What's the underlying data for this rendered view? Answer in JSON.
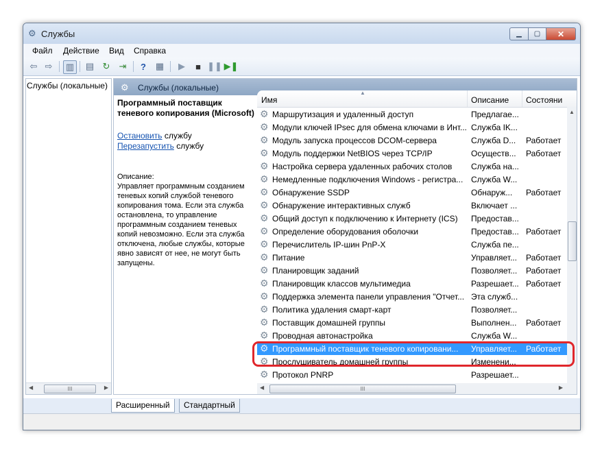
{
  "window": {
    "title": "Службы",
    "icon": "gear-icon"
  },
  "menu": [
    "Файл",
    "Действие",
    "Вид",
    "Справка"
  ],
  "toolbar": {
    "icons": [
      "back-arrow-icon",
      "forward-arrow-icon",
      "show-hide-console-tree-icon",
      "properties-icon",
      "refresh-icon",
      "export-list-icon",
      "help-icon",
      "show-hide-action-pane-icon",
      "start-service-icon",
      "stop-service-icon",
      "pause-service-icon",
      "restart-service-icon"
    ],
    "icon_colors": {
      "play": "#8a9bb0",
      "stop": "#333333",
      "pause": "#8a9bb0",
      "restart": "#2e9a2e"
    }
  },
  "tree": {
    "root": "Службы (локальные)"
  },
  "pane": {
    "header": "Службы (локальные)"
  },
  "description": {
    "title": "Программный поставщик теневого копирования (Microsoft)",
    "stop_link": "Остановить",
    "stop_suffix": " службу",
    "restart_link": "Перезапустить",
    "restart_suffix": " службу",
    "label": "Описание:",
    "text": "Управляет программным созданием теневых копий службой теневого копирования тома. Если эта служба остановлена, то управление программным созданием теневых копий невозможно. Если эта служба отключена, любые службы, которые явно зависят от нее, не могут быть запущены."
  },
  "columns": {
    "name": "Имя",
    "description": "Описание",
    "status": "Состояни"
  },
  "services": [
    {
      "name": "Маршрутизация и удаленный доступ",
      "description": "Предлагае...",
      "status": ""
    },
    {
      "name": "Модули ключей IPsec для обмена ключами в Инт...",
      "description": "Служба IK...",
      "status": ""
    },
    {
      "name": "Модуль запуска процессов DCOM-сервера",
      "description": "Служба D...",
      "status": "Работает"
    },
    {
      "name": "Модуль поддержки NetBIOS через TCP/IP",
      "description": "Осуществ...",
      "status": "Работает"
    },
    {
      "name": "Настройка сервера удаленных рабочих столов",
      "description": "Служба на...",
      "status": ""
    },
    {
      "name": "Немедленные подключения Windows - регистра...",
      "description": "Служба W...",
      "status": ""
    },
    {
      "name": "Обнаружение SSDP",
      "description": "Обнаруж...",
      "status": "Работает"
    },
    {
      "name": "Обнаружение интерактивных служб",
      "description": "Включает ...",
      "status": ""
    },
    {
      "name": "Общий доступ к подключению к Интернету (ICS)",
      "description": "Предостав...",
      "status": ""
    },
    {
      "name": "Определение оборудования оболочки",
      "description": "Предостав...",
      "status": "Работает"
    },
    {
      "name": "Перечислитель IP-шин PnP-X",
      "description": "Служба пе...",
      "status": ""
    },
    {
      "name": "Питание",
      "description": "Управляет...",
      "status": "Работает"
    },
    {
      "name": "Планировщик заданий",
      "description": "Позволяет...",
      "status": "Работает"
    },
    {
      "name": "Планировщик классов мультимедиа",
      "description": "Разрешает...",
      "status": "Работает"
    },
    {
      "name": "Поддержка элемента панели управления \"Отчет...",
      "description": "Эта служб...",
      "status": ""
    },
    {
      "name": "Политика удаления смарт-карт",
      "description": "Позволяет...",
      "status": ""
    },
    {
      "name": "Поставщик домашней группы",
      "description": "Выполнен...",
      "status": "Работает"
    },
    {
      "name": "Проводная автонастройка",
      "description": "Служба W...",
      "status": ""
    },
    {
      "name": "Программный поставщик теневого копировани...",
      "description": "Управляет...",
      "status": "Работает",
      "selected": true
    },
    {
      "name": "Прослушиватель домашней группы",
      "description": "Изменени...",
      "status": ""
    },
    {
      "name": "Протокол PNRP",
      "description": "Разрешает...",
      "status": ""
    }
  ],
  "tabs": [
    "Расширенный",
    "Стандартный"
  ],
  "colors": {
    "selection": "#3399ff",
    "highlight": "#e0262b",
    "pane_header": "#9cb2cc"
  }
}
